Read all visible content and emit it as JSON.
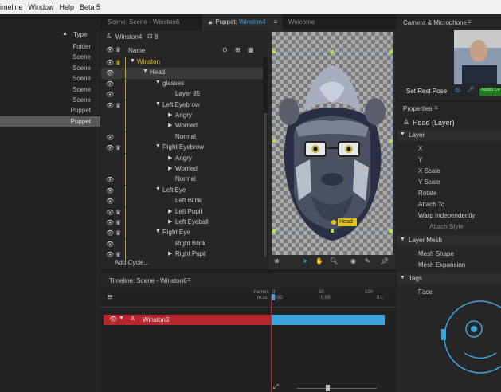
{
  "menu": {
    "items": [
      "imeline",
      "Window",
      "Help",
      "Beta 5"
    ]
  },
  "project": {
    "col_type": "Type",
    "rows": [
      {
        "type": "Folder",
        "selected": false
      },
      {
        "type": "Scene",
        "selected": false
      },
      {
        "type": "Scene",
        "selected": false
      },
      {
        "type": "Scene",
        "selected": false
      },
      {
        "type": "Scene",
        "selected": false
      },
      {
        "type": "Scene",
        "selected": false
      },
      {
        "type": "Puppet",
        "selected": false
      },
      {
        "type": "Puppet",
        "selected": true
      }
    ]
  },
  "tabs": {
    "scene": "Scene: Scene - Winston6",
    "puppet_prefix": "Puppet: ",
    "puppet_name": "Winston4",
    "welcome": "Welcome"
  },
  "puppet": {
    "header_name": "Winston4",
    "header_count": "8",
    "col_name": "Name",
    "add_cycle": "Add Cycle...",
    "tree": [
      {
        "label": "Winston",
        "indent": 0,
        "twisty": "down",
        "eye": true,
        "crown": true,
        "yellow": true,
        "selected": false
      },
      {
        "label": "Head",
        "indent": 1,
        "twisty": "down",
        "eye": true,
        "crown": false,
        "yellow": false,
        "selected": true
      },
      {
        "label": "glasses",
        "indent": 2,
        "twisty": "down",
        "eye": true,
        "crown": false,
        "yellow": false,
        "selected": false
      },
      {
        "label": "Layer 85",
        "indent": 3,
        "twisty": "none",
        "eye": true,
        "crown": false,
        "yellow": false,
        "selected": false
      },
      {
        "label": "Left Eyebrow",
        "indent": 2,
        "twisty": "down",
        "eye": true,
        "crown": true,
        "yellow": false,
        "selected": false
      },
      {
        "label": "Angry",
        "indent": 3,
        "twisty": "right",
        "eye": false,
        "crown": false,
        "yellow": false,
        "selected": false
      },
      {
        "label": "Worried",
        "indent": 3,
        "twisty": "right",
        "eye": false,
        "crown": false,
        "yellow": false,
        "selected": false
      },
      {
        "label": "Normal",
        "indent": 3,
        "twisty": "none",
        "eye": true,
        "crown": false,
        "yellow": false,
        "selected": false
      },
      {
        "label": "Right Eyebrow",
        "indent": 2,
        "twisty": "down",
        "eye": true,
        "crown": true,
        "yellow": false,
        "selected": false
      },
      {
        "label": "Angry",
        "indent": 3,
        "twisty": "right",
        "eye": false,
        "crown": false,
        "yellow": false,
        "selected": false
      },
      {
        "label": "Worried",
        "indent": 3,
        "twisty": "right",
        "eye": false,
        "crown": false,
        "yellow": false,
        "selected": false
      },
      {
        "label": "Normal",
        "indent": 3,
        "twisty": "none",
        "eye": true,
        "crown": false,
        "yellow": false,
        "selected": false
      },
      {
        "label": "Left Eye",
        "indent": 2,
        "twisty": "down",
        "eye": true,
        "crown": false,
        "yellow": false,
        "selected": false
      },
      {
        "label": "Left Blink",
        "indent": 3,
        "twisty": "none",
        "eye": true,
        "crown": false,
        "yellow": false,
        "selected": false
      },
      {
        "label": "Left Pupil",
        "indent": 3,
        "twisty": "right",
        "eye": true,
        "crown": true,
        "yellow": false,
        "selected": false
      },
      {
        "label": "Left Eyeball",
        "indent": 3,
        "twisty": "right",
        "eye": true,
        "crown": true,
        "yellow": false,
        "selected": false
      },
      {
        "label": "Right Eye",
        "indent": 2,
        "twisty": "down",
        "eye": true,
        "crown": true,
        "yellow": false,
        "selected": false
      },
      {
        "label": "Right Blink",
        "indent": 3,
        "twisty": "none",
        "eye": true,
        "crown": false,
        "yellow": false,
        "selected": false
      },
      {
        "label": "Right Pupil",
        "indent": 3,
        "twisty": "right",
        "eye": true,
        "crown": true,
        "yellow": false,
        "selected": false
      }
    ]
  },
  "canvas": {
    "handle_label": "Head"
  },
  "camera": {
    "title": "Camera & Microphone",
    "set_rest_pose": "Set Rest Pose",
    "audio_label": "Audio Le"
  },
  "properties": {
    "title": "Properties",
    "layer_name": "Head (Layer)",
    "sections": [
      {
        "name": "Layer",
        "items": [
          "X",
          "Y",
          "X Scale",
          "Y Scale",
          "Rotate",
          "Attach To",
          "Warp Independently",
          "Attach Style"
        ]
      },
      {
        "name": "Layer Mesh",
        "items": [
          "Mesh Shape",
          "Mesh Expansion"
        ]
      },
      {
        "name": "Tags",
        "items": [
          "Face"
        ]
      }
    ]
  },
  "timeline": {
    "title": "Timeline: Scene - Winston6",
    "frames_label": "frames",
    "mss_label": "m:ss",
    "ticks_frames": [
      "0",
      "50",
      "100"
    ],
    "ticks_time": [
      "0:00",
      "0:05",
      "0:1"
    ],
    "track_name": "Winston3"
  },
  "colors": {
    "accent_blue": "#3aa5dd",
    "track_red": "#b5262d",
    "yellow": "#e2c21b",
    "playhead": "#d02020"
  }
}
